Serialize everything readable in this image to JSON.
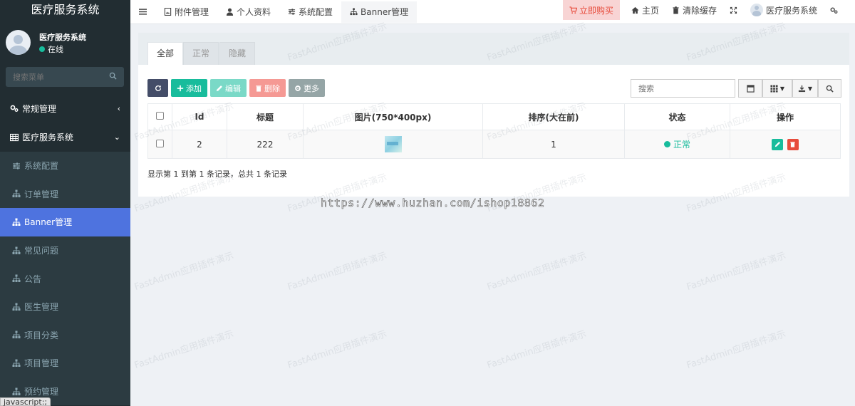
{
  "sidebar": {
    "logo": "医疗服务系统",
    "user": {
      "name": "医疗服务系统",
      "status": "在线"
    },
    "search_placeholder": "搜索菜单",
    "menu": [
      {
        "label": "常规管理",
        "icon": "gears-icon"
      },
      {
        "label": "医疗服务系统",
        "icon": "table-icon"
      },
      {
        "label": "系统配置",
        "icon": "sliders-icon"
      },
      {
        "label": "订单管理",
        "icon": "sitemap-icon"
      },
      {
        "label": "Banner管理",
        "icon": "sitemap-icon"
      },
      {
        "label": "常见问题",
        "icon": "sitemap-icon"
      },
      {
        "label": "公告",
        "icon": "sitemap-icon"
      },
      {
        "label": "医生管理",
        "icon": "sitemap-icon"
      },
      {
        "label": "项目分类",
        "icon": "sitemap-icon"
      },
      {
        "label": "项目管理",
        "icon": "sitemap-icon"
      },
      {
        "label": "预约管理",
        "icon": "sitemap-icon"
      }
    ],
    "status_tooltip": "javascript:;"
  },
  "topbar": {
    "tabs": [
      {
        "label": "附件管理",
        "icon": "file-image-icon"
      },
      {
        "label": "个人资料",
        "icon": "user-icon"
      },
      {
        "label": "系统配置",
        "icon": "sliders-icon"
      },
      {
        "label": "Banner管理",
        "icon": "sitemap-icon"
      }
    ],
    "buy_label": "立即购买",
    "home_label": "主页",
    "clear_cache_label": "清除缓存",
    "user_name": "医疗服务系统"
  },
  "content": {
    "filter_tabs": [
      "全部",
      "正常",
      "隐藏"
    ],
    "toolbar": {
      "add": "添加",
      "edit": "编辑",
      "delete": "删除",
      "more": "更多"
    },
    "search_placeholder": "搜索",
    "columns": [
      "Id",
      "标题",
      "图片(750*400px)",
      "排序(大在前)",
      "状态",
      "操作"
    ],
    "rows": [
      {
        "id": "2",
        "title": "222",
        "sort": "1",
        "status": "正常"
      }
    ],
    "summary": "显示第 1 到第 1 条记录，总共 1 条记录"
  },
  "watermark": {
    "text": "FastAdmin应用插件演示",
    "url": "https://www.huzhan.com/ishop18862"
  },
  "colors": {
    "sidebar_bg": "#222d32",
    "active_menu": "#4e73df",
    "success": "#18bc9c",
    "danger": "#e74c3c"
  }
}
